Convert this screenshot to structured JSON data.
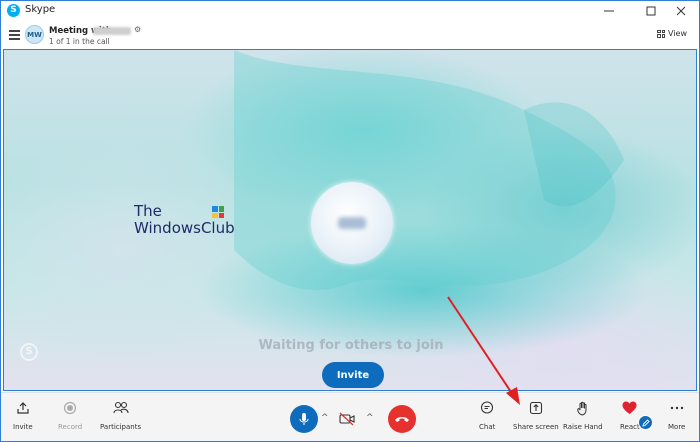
{
  "window": {
    "app_title": "Skype",
    "app_icon_letter": "S"
  },
  "header": {
    "avatar_initials": "MW",
    "meeting_title": "Meeting with",
    "subtitle": "1 of 1 in the call",
    "view_label": "View"
  },
  "stage": {
    "watermark_the": "The",
    "watermark_main": "WindowsClub",
    "waiting_text": "Waiting for others to join",
    "invite_label": "Invite"
  },
  "toolbar": {
    "invite": "Invite",
    "record": "Record",
    "participants": "Participants",
    "chat": "Chat",
    "share_screen": "Share screen",
    "raise_hand": "Raise Hand",
    "react": "React",
    "more": "More"
  },
  "colors": {
    "accent": "#0f6cbd",
    "end_call": "#e6312f",
    "annotation_arrow": "#e02020",
    "react_heart": "#e0242f"
  }
}
